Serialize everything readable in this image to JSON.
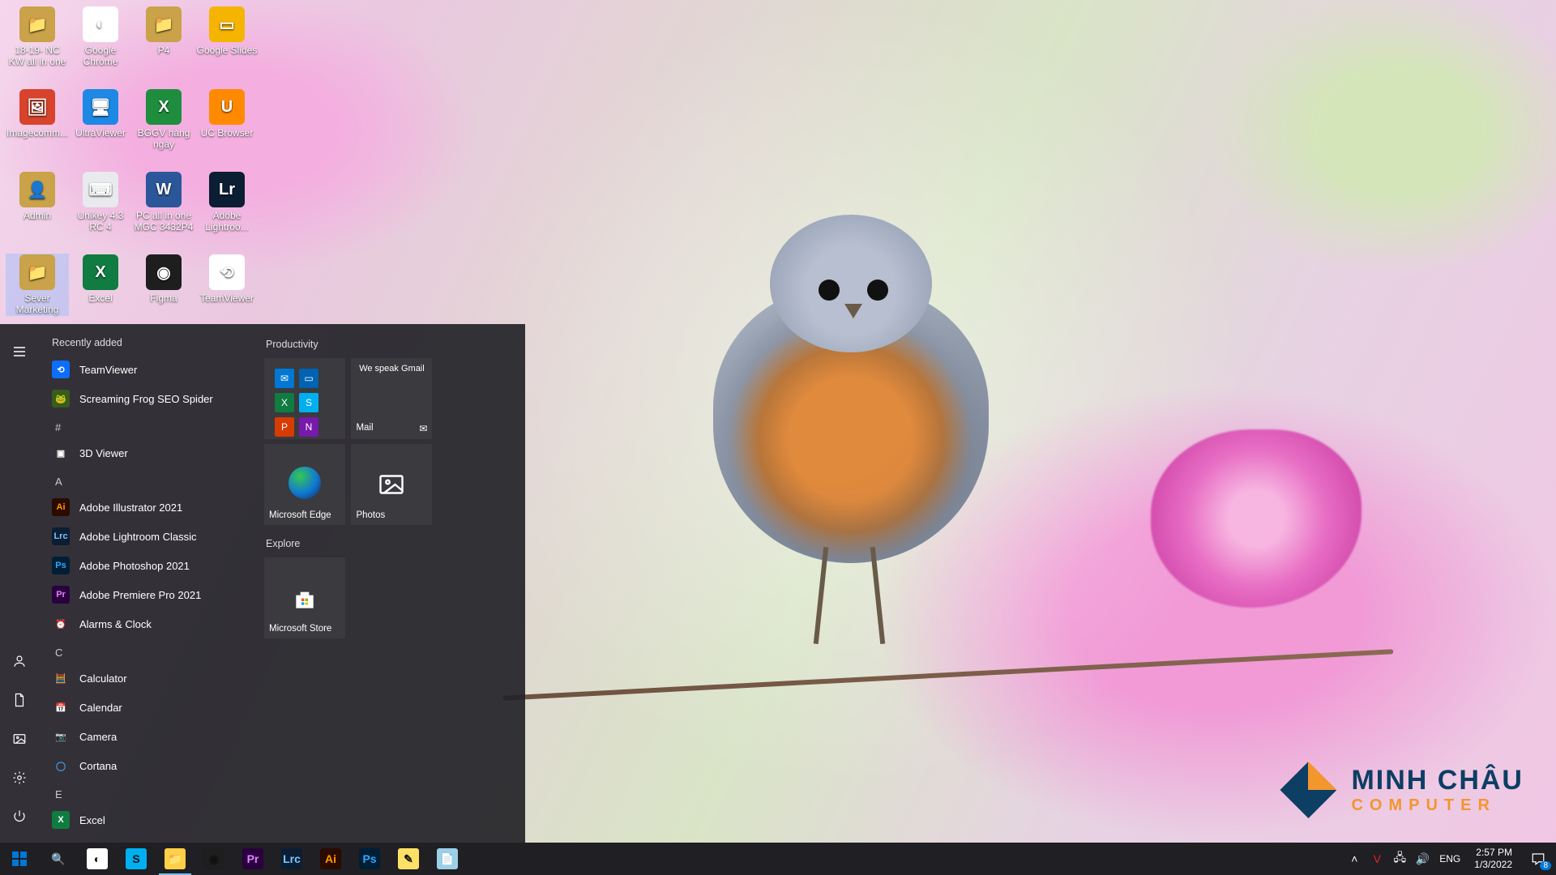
{
  "wallpaper": {
    "description": "Robin bird on branch with pink blossoms"
  },
  "watermark": {
    "line1": "MINH CHÂU",
    "line2": "COMPUTER"
  },
  "desktop_icons": [
    {
      "id": "nc-kw",
      "label": "18-19- NC KW all in one",
      "col": 0,
      "row": 0,
      "bg": "#c9a24a",
      "glyph": "📁"
    },
    {
      "id": "chrome",
      "label": "Google Chrome",
      "col": 1,
      "row": 0,
      "bg": "#ffffff",
      "glyph": "◐"
    },
    {
      "id": "p4",
      "label": "P4",
      "col": 2,
      "row": 0,
      "bg": "#c9a24a",
      "glyph": "📁"
    },
    {
      "id": "gslides",
      "label": "Google Slides",
      "col": 3,
      "row": 0,
      "bg": "#f5b400",
      "glyph": "▭"
    },
    {
      "id": "imagecomm",
      "label": "Imagecomm...",
      "col": 0,
      "row": 1,
      "bg": "#d8432b",
      "glyph": "🖼"
    },
    {
      "id": "ultraviewer",
      "label": "UltraViewer",
      "col": 1,
      "row": 1,
      "bg": "#1e88e5",
      "glyph": "🖥"
    },
    {
      "id": "bggv",
      "label": "BGGV hàng ngày",
      "col": 2,
      "row": 1,
      "bg": "#1e8e3e",
      "glyph": "X"
    },
    {
      "id": "ucbrowser",
      "label": "UC Browser",
      "col": 3,
      "row": 1,
      "bg": "#ff8a00",
      "glyph": "U"
    },
    {
      "id": "admin",
      "label": "Admin",
      "col": 0,
      "row": 2,
      "bg": "#c9a24a",
      "glyph": "👤"
    },
    {
      "id": "unikey",
      "label": "Unikey 4.3 RC 4",
      "col": 1,
      "row": 2,
      "bg": "#e8eaed",
      "glyph": "⌨"
    },
    {
      "id": "pcallinone",
      "label": "PC all in one MGC 3432P4",
      "col": 2,
      "row": 2,
      "bg": "#2b579a",
      "glyph": "W"
    },
    {
      "id": "lrc",
      "label": "Adobe Lightroo...",
      "col": 3,
      "row": 2,
      "bg": "#0b1e33",
      "glyph": "Lr"
    },
    {
      "id": "sever-mkt",
      "label": "Sever Marketing",
      "col": 0,
      "row": 3,
      "bg": "#c9a24a",
      "glyph": "📁"
    },
    {
      "id": "excel",
      "label": "Excel",
      "col": 1,
      "row": 3,
      "bg": "#107c41",
      "glyph": "X"
    },
    {
      "id": "figma",
      "label": "Figma",
      "col": 2,
      "row": 3,
      "bg": "#1e1e1e",
      "glyph": "◉"
    },
    {
      "id": "teamviewer",
      "label": "TeamViewer",
      "col": 3,
      "row": 3,
      "bg": "#ffffff",
      "glyph": "⟲"
    }
  ],
  "start_menu": {
    "recently_added_label": "Recently added",
    "recently_added": [
      {
        "label": "TeamViewer",
        "bg": "#0d6efd",
        "glyph": "⟲"
      },
      {
        "label": "Screaming Frog SEO Spider",
        "bg": "#3a5a1e",
        "glyph": "🐸"
      }
    ],
    "sections": [
      {
        "letter": "#",
        "items": [
          {
            "label": "3D Viewer",
            "bg": "transparent",
            "glyph": "▣"
          }
        ]
      },
      {
        "letter": "A",
        "items": [
          {
            "label": "Adobe Illustrator 2021",
            "bg": "#2b0a00",
            "fg": "#ff9a00",
            "glyph": "Ai"
          },
          {
            "label": "Adobe Lightroom Classic",
            "bg": "#0b1e33",
            "fg": "#7cc7ff",
            "glyph": "Lrc"
          },
          {
            "label": "Adobe Photoshop 2021",
            "bg": "#001e36",
            "fg": "#31a8ff",
            "glyph": "Ps"
          },
          {
            "label": "Adobe Premiere Pro 2021",
            "bg": "#2a003f",
            "fg": "#e085ff",
            "glyph": "Pr"
          },
          {
            "label": "Alarms & Clock",
            "bg": "transparent",
            "glyph": "⏰"
          }
        ]
      },
      {
        "letter": "C",
        "items": [
          {
            "label": "Calculator",
            "bg": "transparent",
            "glyph": "🧮"
          },
          {
            "label": "Calendar",
            "bg": "transparent",
            "glyph": "📅"
          },
          {
            "label": "Camera",
            "bg": "transparent",
            "glyph": "📷"
          },
          {
            "label": "Cortana",
            "bg": "transparent",
            "fg": "#3aa0f3",
            "glyph": "◯"
          }
        ]
      },
      {
        "letter": "E",
        "items": [
          {
            "label": "Excel",
            "bg": "#107c41",
            "glyph": "X"
          }
        ]
      }
    ],
    "tiles": {
      "group1_label": "Productivity",
      "app_folder": [
        {
          "bg": "#0078d4",
          "glyph": "✉"
        },
        {
          "bg": "#0063b1",
          "glyph": "▭"
        },
        {
          "bg": "#107c41",
          "glyph": "X"
        },
        {
          "bg": "#00aff0",
          "glyph": "S"
        },
        {
          "bg": "#d83b01",
          "glyph": "P"
        },
        {
          "bg": "#7719aa",
          "glyph": "N"
        }
      ],
      "mail_tile": {
        "message": "We speak Gmail",
        "label": "Mail"
      },
      "edge_tile": {
        "label": "Microsoft Edge"
      },
      "photos_tile": {
        "label": "Photos"
      },
      "group2_label": "Explore",
      "store_tile": {
        "label": "Microsoft Store"
      }
    }
  },
  "taskbar": {
    "pinned": [
      {
        "id": "start",
        "bg": "transparent"
      },
      {
        "id": "search",
        "bg": "transparent",
        "glyph": "🔍"
      },
      {
        "id": "chrome",
        "bg": "#ffffff",
        "glyph": "◐"
      },
      {
        "id": "skype",
        "bg": "#00aff0",
        "glyph": "S"
      },
      {
        "id": "explorer",
        "bg": "#ffcf48",
        "glyph": "📁",
        "active": true
      },
      {
        "id": "figma",
        "bg": "#1e1e1e",
        "glyph": "◉"
      },
      {
        "id": "premiere",
        "bg": "#2a003f",
        "glyph": "Pr",
        "fg": "#e085ff"
      },
      {
        "id": "lrc",
        "bg": "#0b1e33",
        "glyph": "Lrc",
        "fg": "#7cc7ff"
      },
      {
        "id": "ai",
        "bg": "#2b0a00",
        "glyph": "Ai",
        "fg": "#ff9a00"
      },
      {
        "id": "ps",
        "bg": "#001e36",
        "glyph": "Ps",
        "fg": "#31a8ff"
      },
      {
        "id": "sticky",
        "bg": "#ffe066",
        "glyph": "✎"
      },
      {
        "id": "notepad",
        "bg": "#9cd0e6",
        "glyph": "📄"
      }
    ],
    "tray": {
      "items": [
        {
          "id": "chevron",
          "glyph": "˄"
        },
        {
          "id": "unikey",
          "glyph": "V",
          "fg": "#e02424"
        },
        {
          "id": "network",
          "glyph": "🖧"
        },
        {
          "id": "volume",
          "glyph": "🔊"
        }
      ],
      "lang": "ENG",
      "time": "2:57 PM",
      "date": "1/3/2022",
      "notif_count": "8"
    }
  }
}
